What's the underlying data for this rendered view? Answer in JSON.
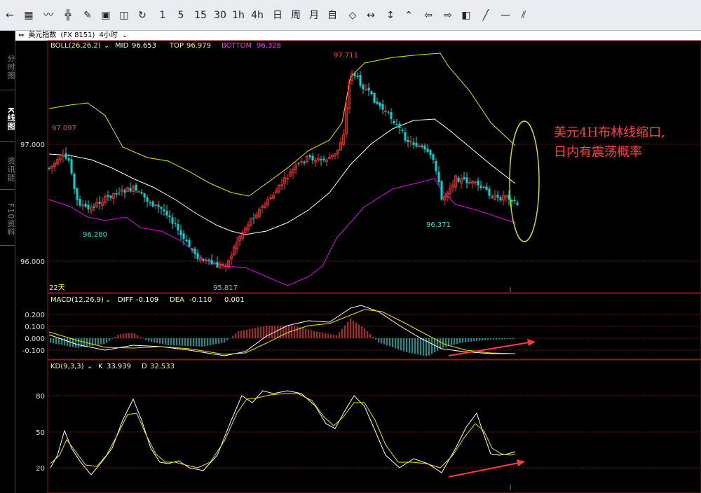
{
  "toolbar": {
    "back_icon": "left-arrow-icon",
    "items": [
      {
        "icon": "grid-icon"
      },
      {
        "icon": "line-chart-icon"
      },
      {
        "icon": "candlestick-icon"
      },
      {
        "icon": "pen-icon"
      },
      {
        "icon": "table-icon"
      },
      {
        "icon": "window-icon"
      },
      {
        "icon": "refresh-icon"
      }
    ],
    "periods": [
      "1",
      "5",
      "15",
      "30",
      "1h",
      "4h",
      "日",
      "周",
      "月",
      "自"
    ],
    "tools": [
      {
        "icon": "diamond-arrows-icon"
      },
      {
        "icon": "left-right-arrow-icon"
      },
      {
        "icon": "up-down-arrow-icon"
      },
      {
        "icon": "up-chevron-icon"
      },
      {
        "icon": "arrow-left-icon"
      },
      {
        "icon": "arrow-right-icon"
      },
      {
        "icon": "layout-icon"
      },
      {
        "icon": "draw-line-icon"
      },
      {
        "icon": "horizontal-line-icon"
      },
      {
        "icon": "parallel-lines-icon"
      }
    ]
  },
  "infobar": {
    "symbol_icon": "link-icon",
    "symbol": "美元指数",
    "code": "(FX 8151)",
    "period": "4小时"
  },
  "sidebar": {
    "tabs": [
      "分时图",
      "K线图",
      "资讯链",
      "F10资料"
    ],
    "active": 1
  },
  "boll": {
    "name": "BOLL(26,26,2)",
    "mid_label": "MID",
    "mid": "96.653",
    "top_label": "TOP",
    "top": "96.979",
    "bottom_label": "BOTTOM",
    "bottom": "96.328",
    "colors": {
      "mid": "#ffffff",
      "top": "#e6e600",
      "bottom": "#e600e6"
    }
  },
  "price_axis": {
    "ticks": [
      "97.000",
      "96.000"
    ]
  },
  "price_annotations": {
    "high_left": "97.097",
    "low_left": "96.280",
    "high": "97.711",
    "low": "95.817",
    "low_right": "96.371",
    "period_marker": "22天"
  },
  "macd": {
    "name": "MACD(12,26,9)",
    "diff_label": "DIFF",
    "diff": "-0.109",
    "dea_label": "DEA",
    "dea": "-0.110",
    "value": "0.001",
    "ticks": [
      "0.200",
      "0.100",
      "0.000",
      "-0.100"
    ]
  },
  "kd": {
    "name": "KD(9,3,3)",
    "k_label": "K",
    "k": "33.939",
    "d_label": "D",
    "d": "32.533",
    "ticks": [
      "80",
      "50",
      "20"
    ]
  },
  "annotation": {
    "line1": "美元4H布林线缩口,",
    "line2": "日内有震荡概率"
  },
  "colors": {
    "bull": "#ff3333",
    "bear": "#00d8d8",
    "annotation": "#ff4040",
    "ellipse": "#e6e600"
  }
}
